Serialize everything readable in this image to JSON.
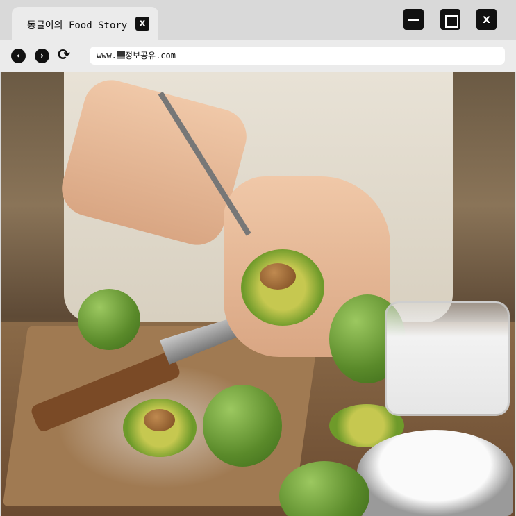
{
  "tab": {
    "title": "동글이의 Food Story",
    "close_label": "x"
  },
  "window": {
    "close_label": "x"
  },
  "nav": {
    "back": "‹",
    "forward": "›",
    "reload": "⟳"
  },
  "address_bar": {
    "prefix": "www.",
    "domain": "정보공유.com"
  },
  "content": {
    "image_description_icon": "photo"
  }
}
